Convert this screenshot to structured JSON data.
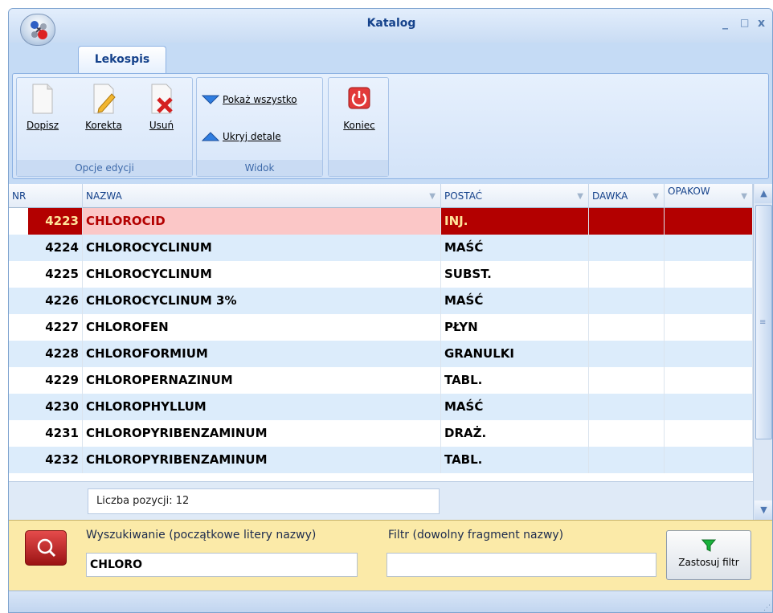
{
  "window": {
    "title": "Katalog",
    "minimize": "_",
    "maximize": "□",
    "close": "x"
  },
  "ribbon": {
    "tab": "Lekospis",
    "groups": {
      "edit": {
        "label": "Opcje edycji",
        "add": "Dopisz",
        "edit": "Korekta",
        "delete": "Usuń"
      },
      "view": {
        "label": "Widok",
        "show_all": "Pokaż wszystko",
        "hide_details": "Ukryj detale"
      },
      "end": {
        "exit": "Koniec"
      }
    }
  },
  "grid": {
    "columns": {
      "nr": "NR",
      "nazwa": "NAZWA",
      "postac": "POSTAĆ",
      "dawka": "DAWKA",
      "opakow": "OPAKOW"
    },
    "rows": [
      {
        "nr": "4223",
        "nazwa": "CHLOROCID",
        "postac": "INJ."
      },
      {
        "nr": "4224",
        "nazwa": "CHLOROCYCLINUM",
        "postac": "MAŚĆ"
      },
      {
        "nr": "4225",
        "nazwa": "CHLOROCYCLINUM",
        "postac": "SUBST."
      },
      {
        "nr": "4226",
        "nazwa": "CHLOROCYCLINUM 3%",
        "postac": "MAŚĆ"
      },
      {
        "nr": "4227",
        "nazwa": "CHLOROFEN",
        "postac": "PŁYN"
      },
      {
        "nr": "4228",
        "nazwa": "CHLOROFORMIUM",
        "postac": "GRANULKI"
      },
      {
        "nr": "4229",
        "nazwa": "CHLOROPERNAZINUM",
        "postac": "TABL."
      },
      {
        "nr": "4230",
        "nazwa": "CHLOROPHYLLUM",
        "postac": "MAŚĆ"
      },
      {
        "nr": "4231",
        "nazwa": "CHLOROPYRIBENZAMINUM",
        "postac": "DRAŻ."
      },
      {
        "nr": "4232",
        "nazwa": "CHLOROPYRIBENZAMINUM",
        "postac": "TABL."
      }
    ],
    "count_label": "Liczba pozycji: 12"
  },
  "search": {
    "prefix_label": "Wyszukiwanie (początkowe litery nazwy)",
    "prefix_value": "CHLORO",
    "filter_label": "Filtr (dowolny fragment nazwy)",
    "filter_value": "",
    "apply": "Zastosuj filtr"
  },
  "colors": {
    "selected_bg": "#b30000",
    "selected_text": "#ffe49a",
    "selected_name_bg": "#fbc7c7",
    "alt_row": "#dcecfb"
  }
}
